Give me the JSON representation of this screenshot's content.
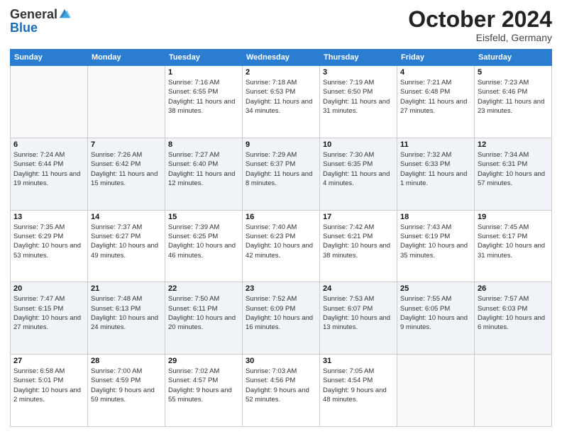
{
  "header": {
    "logo_general": "General",
    "logo_blue": "Blue",
    "month": "October 2024",
    "location": "Eisfeld, Germany"
  },
  "days_of_week": [
    "Sunday",
    "Monday",
    "Tuesday",
    "Wednesday",
    "Thursday",
    "Friday",
    "Saturday"
  ],
  "weeks": [
    [
      {
        "day": "",
        "sunrise": "",
        "sunset": "",
        "daylight": ""
      },
      {
        "day": "",
        "sunrise": "",
        "sunset": "",
        "daylight": ""
      },
      {
        "day": "1",
        "sunrise": "Sunrise: 7:16 AM",
        "sunset": "Sunset: 6:55 PM",
        "daylight": "Daylight: 11 hours and 38 minutes."
      },
      {
        "day": "2",
        "sunrise": "Sunrise: 7:18 AM",
        "sunset": "Sunset: 6:53 PM",
        "daylight": "Daylight: 11 hours and 34 minutes."
      },
      {
        "day": "3",
        "sunrise": "Sunrise: 7:19 AM",
        "sunset": "Sunset: 6:50 PM",
        "daylight": "Daylight: 11 hours and 31 minutes."
      },
      {
        "day": "4",
        "sunrise": "Sunrise: 7:21 AM",
        "sunset": "Sunset: 6:48 PM",
        "daylight": "Daylight: 11 hours and 27 minutes."
      },
      {
        "day": "5",
        "sunrise": "Sunrise: 7:23 AM",
        "sunset": "Sunset: 6:46 PM",
        "daylight": "Daylight: 11 hours and 23 minutes."
      }
    ],
    [
      {
        "day": "6",
        "sunrise": "Sunrise: 7:24 AM",
        "sunset": "Sunset: 6:44 PM",
        "daylight": "Daylight: 11 hours and 19 minutes."
      },
      {
        "day": "7",
        "sunrise": "Sunrise: 7:26 AM",
        "sunset": "Sunset: 6:42 PM",
        "daylight": "Daylight: 11 hours and 15 minutes."
      },
      {
        "day": "8",
        "sunrise": "Sunrise: 7:27 AM",
        "sunset": "Sunset: 6:40 PM",
        "daylight": "Daylight: 11 hours and 12 minutes."
      },
      {
        "day": "9",
        "sunrise": "Sunrise: 7:29 AM",
        "sunset": "Sunset: 6:37 PM",
        "daylight": "Daylight: 11 hours and 8 minutes."
      },
      {
        "day": "10",
        "sunrise": "Sunrise: 7:30 AM",
        "sunset": "Sunset: 6:35 PM",
        "daylight": "Daylight: 11 hours and 4 minutes."
      },
      {
        "day": "11",
        "sunrise": "Sunrise: 7:32 AM",
        "sunset": "Sunset: 6:33 PM",
        "daylight": "Daylight: 11 hours and 1 minute."
      },
      {
        "day": "12",
        "sunrise": "Sunrise: 7:34 AM",
        "sunset": "Sunset: 6:31 PM",
        "daylight": "Daylight: 10 hours and 57 minutes."
      }
    ],
    [
      {
        "day": "13",
        "sunrise": "Sunrise: 7:35 AM",
        "sunset": "Sunset: 6:29 PM",
        "daylight": "Daylight: 10 hours and 53 minutes."
      },
      {
        "day": "14",
        "sunrise": "Sunrise: 7:37 AM",
        "sunset": "Sunset: 6:27 PM",
        "daylight": "Daylight: 10 hours and 49 minutes."
      },
      {
        "day": "15",
        "sunrise": "Sunrise: 7:39 AM",
        "sunset": "Sunset: 6:25 PM",
        "daylight": "Daylight: 10 hours and 46 minutes."
      },
      {
        "day": "16",
        "sunrise": "Sunrise: 7:40 AM",
        "sunset": "Sunset: 6:23 PM",
        "daylight": "Daylight: 10 hours and 42 minutes."
      },
      {
        "day": "17",
        "sunrise": "Sunrise: 7:42 AM",
        "sunset": "Sunset: 6:21 PM",
        "daylight": "Daylight: 10 hours and 38 minutes."
      },
      {
        "day": "18",
        "sunrise": "Sunrise: 7:43 AM",
        "sunset": "Sunset: 6:19 PM",
        "daylight": "Daylight: 10 hours and 35 minutes."
      },
      {
        "day": "19",
        "sunrise": "Sunrise: 7:45 AM",
        "sunset": "Sunset: 6:17 PM",
        "daylight": "Daylight: 10 hours and 31 minutes."
      }
    ],
    [
      {
        "day": "20",
        "sunrise": "Sunrise: 7:47 AM",
        "sunset": "Sunset: 6:15 PM",
        "daylight": "Daylight: 10 hours and 27 minutes."
      },
      {
        "day": "21",
        "sunrise": "Sunrise: 7:48 AM",
        "sunset": "Sunset: 6:13 PM",
        "daylight": "Daylight: 10 hours and 24 minutes."
      },
      {
        "day": "22",
        "sunrise": "Sunrise: 7:50 AM",
        "sunset": "Sunset: 6:11 PM",
        "daylight": "Daylight: 10 hours and 20 minutes."
      },
      {
        "day": "23",
        "sunrise": "Sunrise: 7:52 AM",
        "sunset": "Sunset: 6:09 PM",
        "daylight": "Daylight: 10 hours and 16 minutes."
      },
      {
        "day": "24",
        "sunrise": "Sunrise: 7:53 AM",
        "sunset": "Sunset: 6:07 PM",
        "daylight": "Daylight: 10 hours and 13 minutes."
      },
      {
        "day": "25",
        "sunrise": "Sunrise: 7:55 AM",
        "sunset": "Sunset: 6:05 PM",
        "daylight": "Daylight: 10 hours and 9 minutes."
      },
      {
        "day": "26",
        "sunrise": "Sunrise: 7:57 AM",
        "sunset": "Sunset: 6:03 PM",
        "daylight": "Daylight: 10 hours and 6 minutes."
      }
    ],
    [
      {
        "day": "27",
        "sunrise": "Sunrise: 6:58 AM",
        "sunset": "Sunset: 5:01 PM",
        "daylight": "Daylight: 10 hours and 2 minutes."
      },
      {
        "day": "28",
        "sunrise": "Sunrise: 7:00 AM",
        "sunset": "Sunset: 4:59 PM",
        "daylight": "Daylight: 9 hours and 59 minutes."
      },
      {
        "day": "29",
        "sunrise": "Sunrise: 7:02 AM",
        "sunset": "Sunset: 4:57 PM",
        "daylight": "Daylight: 9 hours and 55 minutes."
      },
      {
        "day": "30",
        "sunrise": "Sunrise: 7:03 AM",
        "sunset": "Sunset: 4:56 PM",
        "daylight": "Daylight: 9 hours and 52 minutes."
      },
      {
        "day": "31",
        "sunrise": "Sunrise: 7:05 AM",
        "sunset": "Sunset: 4:54 PM",
        "daylight": "Daylight: 9 hours and 48 minutes."
      },
      {
        "day": "",
        "sunrise": "",
        "sunset": "",
        "daylight": ""
      },
      {
        "day": "",
        "sunrise": "",
        "sunset": "",
        "daylight": ""
      }
    ]
  ]
}
